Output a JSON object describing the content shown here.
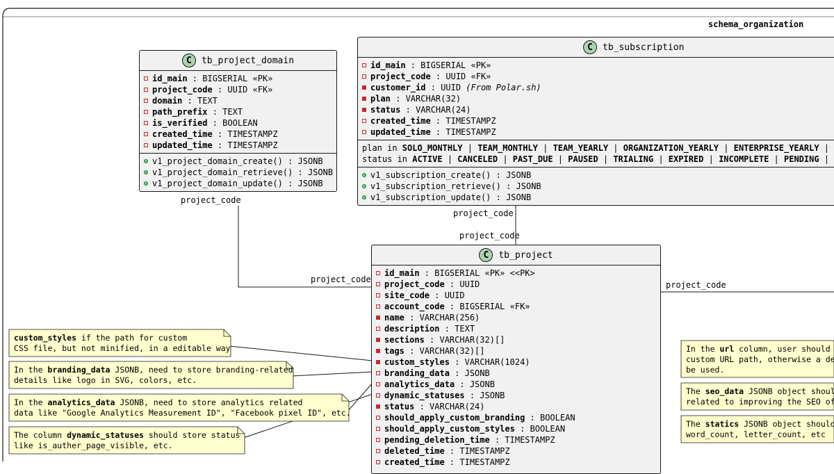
{
  "schema": {
    "title": "schema_organization"
  },
  "classes": {
    "project_domain": {
      "stereotype": "C",
      "name": "tb_project_domain",
      "fields": [
        {
          "marker": "open",
          "name": "id_main",
          "type": " : BIGSERIAL «PK»"
        },
        {
          "marker": "open",
          "name": "project_code",
          "type": " : UUID «FK»"
        },
        {
          "marker": "open",
          "name": "domain",
          "type": " : TEXT"
        },
        {
          "marker": "open",
          "name": "path_prefix",
          "type": " : TEXT"
        },
        {
          "marker": "open",
          "name": "is_verified",
          "type": " : BOOLEAN"
        },
        {
          "marker": "open",
          "name": "created_time",
          "type": " : TIMESTAMPZ"
        },
        {
          "marker": "open",
          "name": "updated_time",
          "type": " : TIMESTAMPZ"
        }
      ],
      "methods": [
        "v1_project_domain_create() : JSONB",
        "v1_project_domain_retrieve() : JSONB",
        "v1_project_domain_update() : JSONB"
      ]
    },
    "subscription": {
      "stereotype": "C",
      "name": "tb_subscription",
      "fields": [
        {
          "marker": "open",
          "name": "id_main",
          "type": " : BIGSERIAL «PK»"
        },
        {
          "marker": "open",
          "name": "project_code",
          "type": " : UUID «FK»"
        },
        {
          "marker": "filled",
          "name": "customer_id",
          "type": " : UUID ",
          "comment": "(From Polar.sh)"
        },
        {
          "marker": "filled",
          "name": "plan",
          "type": " : VARCHAR(32)"
        },
        {
          "marker": "filled",
          "name": "status",
          "type": " : VARCHAR(24)"
        },
        {
          "marker": "open",
          "name": "created_time",
          "type": " : TIMESTAMPZ"
        },
        {
          "marker": "open",
          "name": "updated_time",
          "type": " : TIMESTAMPZ"
        }
      ],
      "constraints": [
        {
          "prefix": "plan in ",
          "values": [
            "SOLO_MONTHLY",
            "TEAM_MONTHLY",
            "TEAM_YEARLY",
            "ORGANIZATION_YEARLY",
            "ENTERPRISE_YEARLY"
          ]
        },
        {
          "prefix": "status in ",
          "values": [
            "ACTIVE",
            "CANCELED",
            "PAST_DUE",
            "PAUSED",
            "TRIALING",
            "EXPIRED",
            "INCOMPLETE",
            "PENDING"
          ]
        }
      ],
      "methods": [
        "v1_subscription_create() : JSONB",
        "v1_subscription_retrieve() : JSONB",
        "v1_subscription_update() : JSONB"
      ]
    },
    "project": {
      "stereotype": "C",
      "name": "tb_project",
      "fields": [
        {
          "marker": "open",
          "name": "id_main",
          "type": " : BIGSERIAL «PK» <<PK>"
        },
        {
          "marker": "open",
          "name": "project_code",
          "type": " : UUID"
        },
        {
          "marker": "open",
          "name": "site_code",
          "type": " : UUID"
        },
        {
          "marker": "open",
          "name": "account_code",
          "type": " : BIGSERIAL «FK»"
        },
        {
          "marker": "filled",
          "name": "name",
          "type": " : VARCHAR(256)"
        },
        {
          "marker": "open",
          "name": "description",
          "type": " : TEXT"
        },
        {
          "marker": "filled",
          "name": "sections",
          "type": " : VARCHAR(32)[]"
        },
        {
          "marker": "filled",
          "name": "tags",
          "type": " : VARCHAR(32)[]"
        },
        {
          "marker": "filled",
          "name": "custom_styles",
          "type": " : VARCHAR(1024)"
        },
        {
          "marker": "open",
          "name": "branding_data",
          "type": " : JSONB"
        },
        {
          "marker": "open",
          "name": "analytics_data",
          "type": " : JSONB"
        },
        {
          "marker": "open",
          "name": "dynamic_statuses",
          "type": " : JSONB"
        },
        {
          "marker": "filled",
          "name": "status",
          "type": " : VARCHAR(24)"
        },
        {
          "marker": "open",
          "name": "should_apply_custom_branding",
          "type": " : BOOLEAN"
        },
        {
          "marker": "open",
          "name": "should_apply_custom_styles",
          "type": " : BOOLEAN"
        },
        {
          "marker": "open",
          "name": "pending_deletion_time",
          "type": " : TIMESTAMPZ"
        },
        {
          "marker": "open",
          "name": "deleted_time",
          "type": " : TIMESTAMPZ"
        },
        {
          "marker": "open",
          "name": "created_time",
          "type": " : TIMESTAMPZ"
        }
      ]
    }
  },
  "relations": {
    "domain_side": "project_code",
    "domain_target": "project_code",
    "subscription_side": "project_code",
    "subscription_target": "project_code",
    "right_side": "project_code"
  },
  "notes_left": [
    [
      {
        "b": "custom_styles",
        "t": " if the path for custom"
      },
      {
        "t": "CSS file, but not minified, in a editable way"
      }
    ],
    [
      {
        "t": "In the "
      },
      {
        "b": "branding_data",
        "t": " JSONB, need to store branding-related"
      },
      {
        "t": "details like logo in SVG, colors, etc."
      }
    ],
    [
      {
        "t": "In the "
      },
      {
        "b": "analytics_data",
        "t": " JSONB, need to store analytics related"
      },
      {
        "t": "data like \"Google Analytics Measurement ID\", \"Facebook pixel ID\", etc."
      }
    ],
    [
      {
        "t": "The column "
      },
      {
        "b": "dynamic_statuses",
        "t": " should store status"
      },
      {
        "t": "like is_auther_page_visible, etc."
      }
    ]
  ],
  "notes_right": [
    [
      {
        "t": "In the "
      },
      {
        "b": "url",
        "t": " column, user should b"
      },
      {
        "t": "custom URL path, otherwise a def"
      },
      {
        "t": "be used."
      }
    ],
    [
      {
        "t": "The "
      },
      {
        "b": "seo_data",
        "t": " JSONB object should"
      },
      {
        "t": "related to improving the SEO of"
      }
    ],
    [
      {
        "t": "The "
      },
      {
        "b": "statics",
        "t": " JSONB object should"
      },
      {
        "t": "word_count, letter_count, etc"
      }
    ]
  ]
}
